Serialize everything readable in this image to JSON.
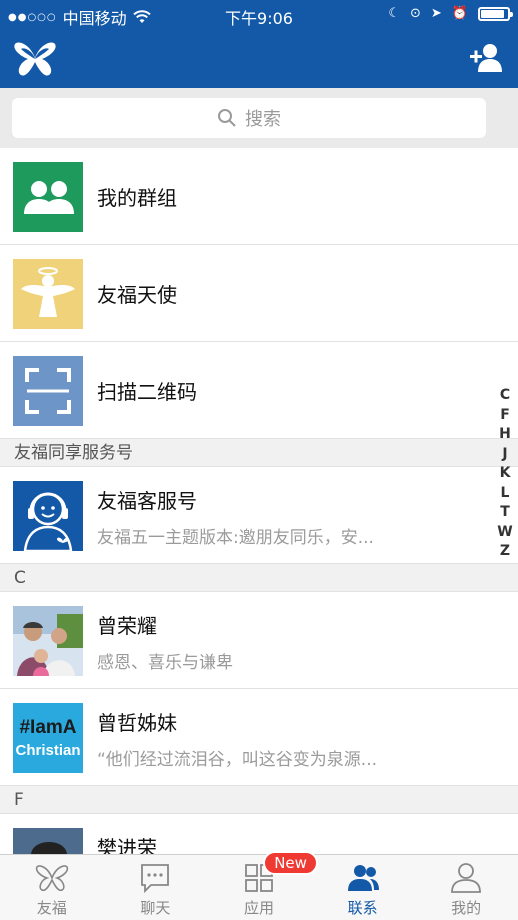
{
  "status": {
    "carrier": "中国移动",
    "time": "下午9:06",
    "battery_level": 0.9
  },
  "header": {
    "logo_icon": "butterfly-logo-icon",
    "add_contact_icon": "add-contact-icon"
  },
  "search": {
    "placeholder": "搜索"
  },
  "top_items": [
    {
      "label": "我的群组",
      "icon": "group-icon",
      "color": "#1d9a5c"
    },
    {
      "label": "友福天使",
      "icon": "angel-icon",
      "color": "#f0d27a"
    },
    {
      "label": "扫描二维码",
      "icon": "scan-icon",
      "color": "#6e95c8"
    }
  ],
  "sections": [
    {
      "header": "友福同享服务号",
      "items": [
        {
          "title": "友福客服号",
          "subtitle": "友福五一主题版本:邀朋友同乐，安..."
        }
      ]
    },
    {
      "header": "C",
      "items": [
        {
          "title": "曾荣耀",
          "subtitle": "感恩、喜乐与谦卑"
        },
        {
          "title": "曾哲姊妹",
          "subtitle": "“他们经过流泪谷，叫这谷变为泉源..."
        }
      ]
    },
    {
      "header": "F",
      "items": [
        {
          "title": "樊进荣",
          "subtitle": ""
        }
      ]
    }
  ],
  "alpha_index": [
    "C",
    "F",
    "H",
    "J",
    "K",
    "L",
    "T",
    "W",
    "Z"
  ],
  "tabs": [
    {
      "label": "友福",
      "icon": "butterfly-icon"
    },
    {
      "label": "聊天",
      "icon": "chat-icon"
    },
    {
      "label": "应用",
      "icon": "apps-icon",
      "badge": "New"
    },
    {
      "label": "联系",
      "icon": "contacts-icon",
      "active": true
    },
    {
      "label": "我的",
      "icon": "profile-icon"
    }
  ],
  "avatar_texts": {
    "christian_line1": "#IamA",
    "christian_line2": "Christian"
  }
}
